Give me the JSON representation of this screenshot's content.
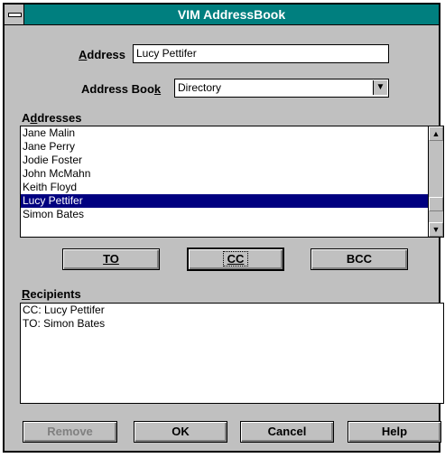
{
  "window": {
    "title": "VIM AddressBook"
  },
  "address": {
    "label": "Address",
    "value": "Lucy Pettifer"
  },
  "address_book": {
    "label": "Address Book",
    "value": "Directory"
  },
  "addresses": {
    "label": "Addresses",
    "items": [
      "Jane Malin",
      "Jane Perry",
      "Jodie Foster",
      "John McMahn",
      "Keith Floyd",
      "Lucy Pettifer",
      "Simon Bates"
    ],
    "selected": "Lucy Pettifer"
  },
  "buttons": {
    "to": "TO",
    "cc": "CC",
    "bcc": "BCC",
    "remove": "Remove",
    "ok": "OK",
    "cancel": "Cancel",
    "help": "Help"
  },
  "recipients": {
    "label": "Recipients",
    "items": [
      "CC: Lucy Pettifer",
      "TO: Simon Bates"
    ]
  },
  "icons": {
    "scroll_up": "up-arrow-icon",
    "scroll_down": "down-arrow-icon",
    "dropdown": "down-arrow-icon",
    "system_menu": "system-menu-icon"
  },
  "colors": {
    "title_bar": "#007f7f",
    "selection": "#000080",
    "dialog": "#c0c0c0"
  }
}
